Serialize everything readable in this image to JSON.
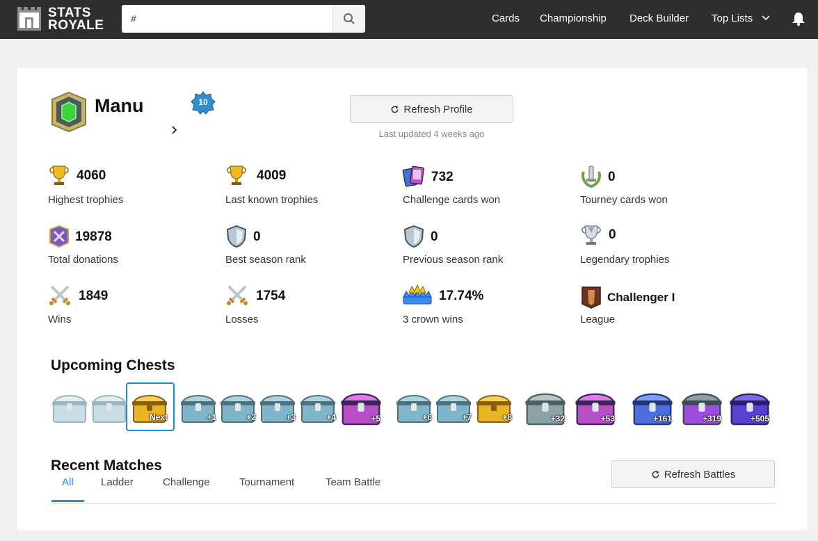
{
  "brand": {
    "line1": "STATS",
    "line2": "ROYALE"
  },
  "search": {
    "value": "#",
    "placeholder": ""
  },
  "nav": [
    {
      "label": "Cards"
    },
    {
      "label": "Championship"
    },
    {
      "label": "Deck Builder"
    },
    {
      "label": "Top Lists"
    }
  ],
  "profile": {
    "name": "Manu",
    "level": "10",
    "refresh_label": "Refresh Profile",
    "last_updated": "Last updated 4 weeks ago"
  },
  "stats": [
    {
      "value": "4060",
      "label": "Highest trophies",
      "icon": "trophy-icon"
    },
    {
      "value": "4009",
      "label": "Last known trophies",
      "icon": "trophy-icon"
    },
    {
      "value": "732",
      "label": "Challenge cards won",
      "icon": "cards-icon"
    },
    {
      "value": "0",
      "label": "Tourney cards won",
      "icon": "tournament-icon"
    },
    {
      "value": "19878",
      "label": "Total donations",
      "icon": "donations-icon"
    },
    {
      "value": "0",
      "label": "Best season rank",
      "icon": "shield-icon"
    },
    {
      "value": "0",
      "label": "Previous season rank",
      "icon": "shield-icon"
    },
    {
      "value": "0",
      "label": "Legendary trophies",
      "icon": "legendary-trophy-icon"
    },
    {
      "value": "1849",
      "label": "Wins",
      "icon": "crossed-swords-icon"
    },
    {
      "value": "1754",
      "label": "Losses",
      "icon": "crossed-swords-icon"
    },
    {
      "value": "17.74%",
      "label": "3 crown wins",
      "icon": "crowns-icon"
    },
    {
      "value": "Challenger I",
      "label": "League",
      "icon": "league-icon"
    }
  ],
  "chests": {
    "title": "Upcoming Chests",
    "items": [
      {
        "type": "silver",
        "label": ""
      },
      {
        "type": "silver",
        "label": ""
      },
      {
        "type": "golden",
        "label": "Next"
      },
      {
        "type": "silver",
        "label": "+1"
      },
      {
        "type": "silver",
        "label": "+2"
      },
      {
        "type": "silver",
        "label": "+3"
      },
      {
        "type": "silver",
        "label": "+4"
      },
      {
        "type": "magical",
        "label": "+5"
      },
      {
        "type": "silver",
        "label": "+6"
      },
      {
        "type": "silver",
        "label": "+7"
      },
      {
        "type": "golden",
        "label": "+8"
      },
      {
        "type": "giant",
        "label": "+32"
      },
      {
        "type": "magical",
        "label": "+53"
      },
      {
        "type": "super-magical",
        "label": "+161"
      },
      {
        "type": "epic",
        "label": "+319"
      },
      {
        "type": "legendary",
        "label": "+505"
      }
    ]
  },
  "matches": {
    "title": "Recent Matches",
    "refresh_label": "Refresh Battles",
    "tabs": [
      {
        "label": "All"
      },
      {
        "label": "Ladder"
      },
      {
        "label": "Challenge"
      },
      {
        "label": "Tournament"
      },
      {
        "label": "Team Battle"
      }
    ]
  },
  "colors": {
    "topbar": "#2e2e2e",
    "accent": "#2b8ce0",
    "silver_chest": "#7fb6cc",
    "golden_chest": "#e8b423",
    "magical_chest": "#b84fc7",
    "giant_chest": "#8ca3a8",
    "super_magical_chest": "#4c6fe0",
    "epic_chest": "#9c4de0",
    "legendary_chest": "#5a3fd0"
  }
}
